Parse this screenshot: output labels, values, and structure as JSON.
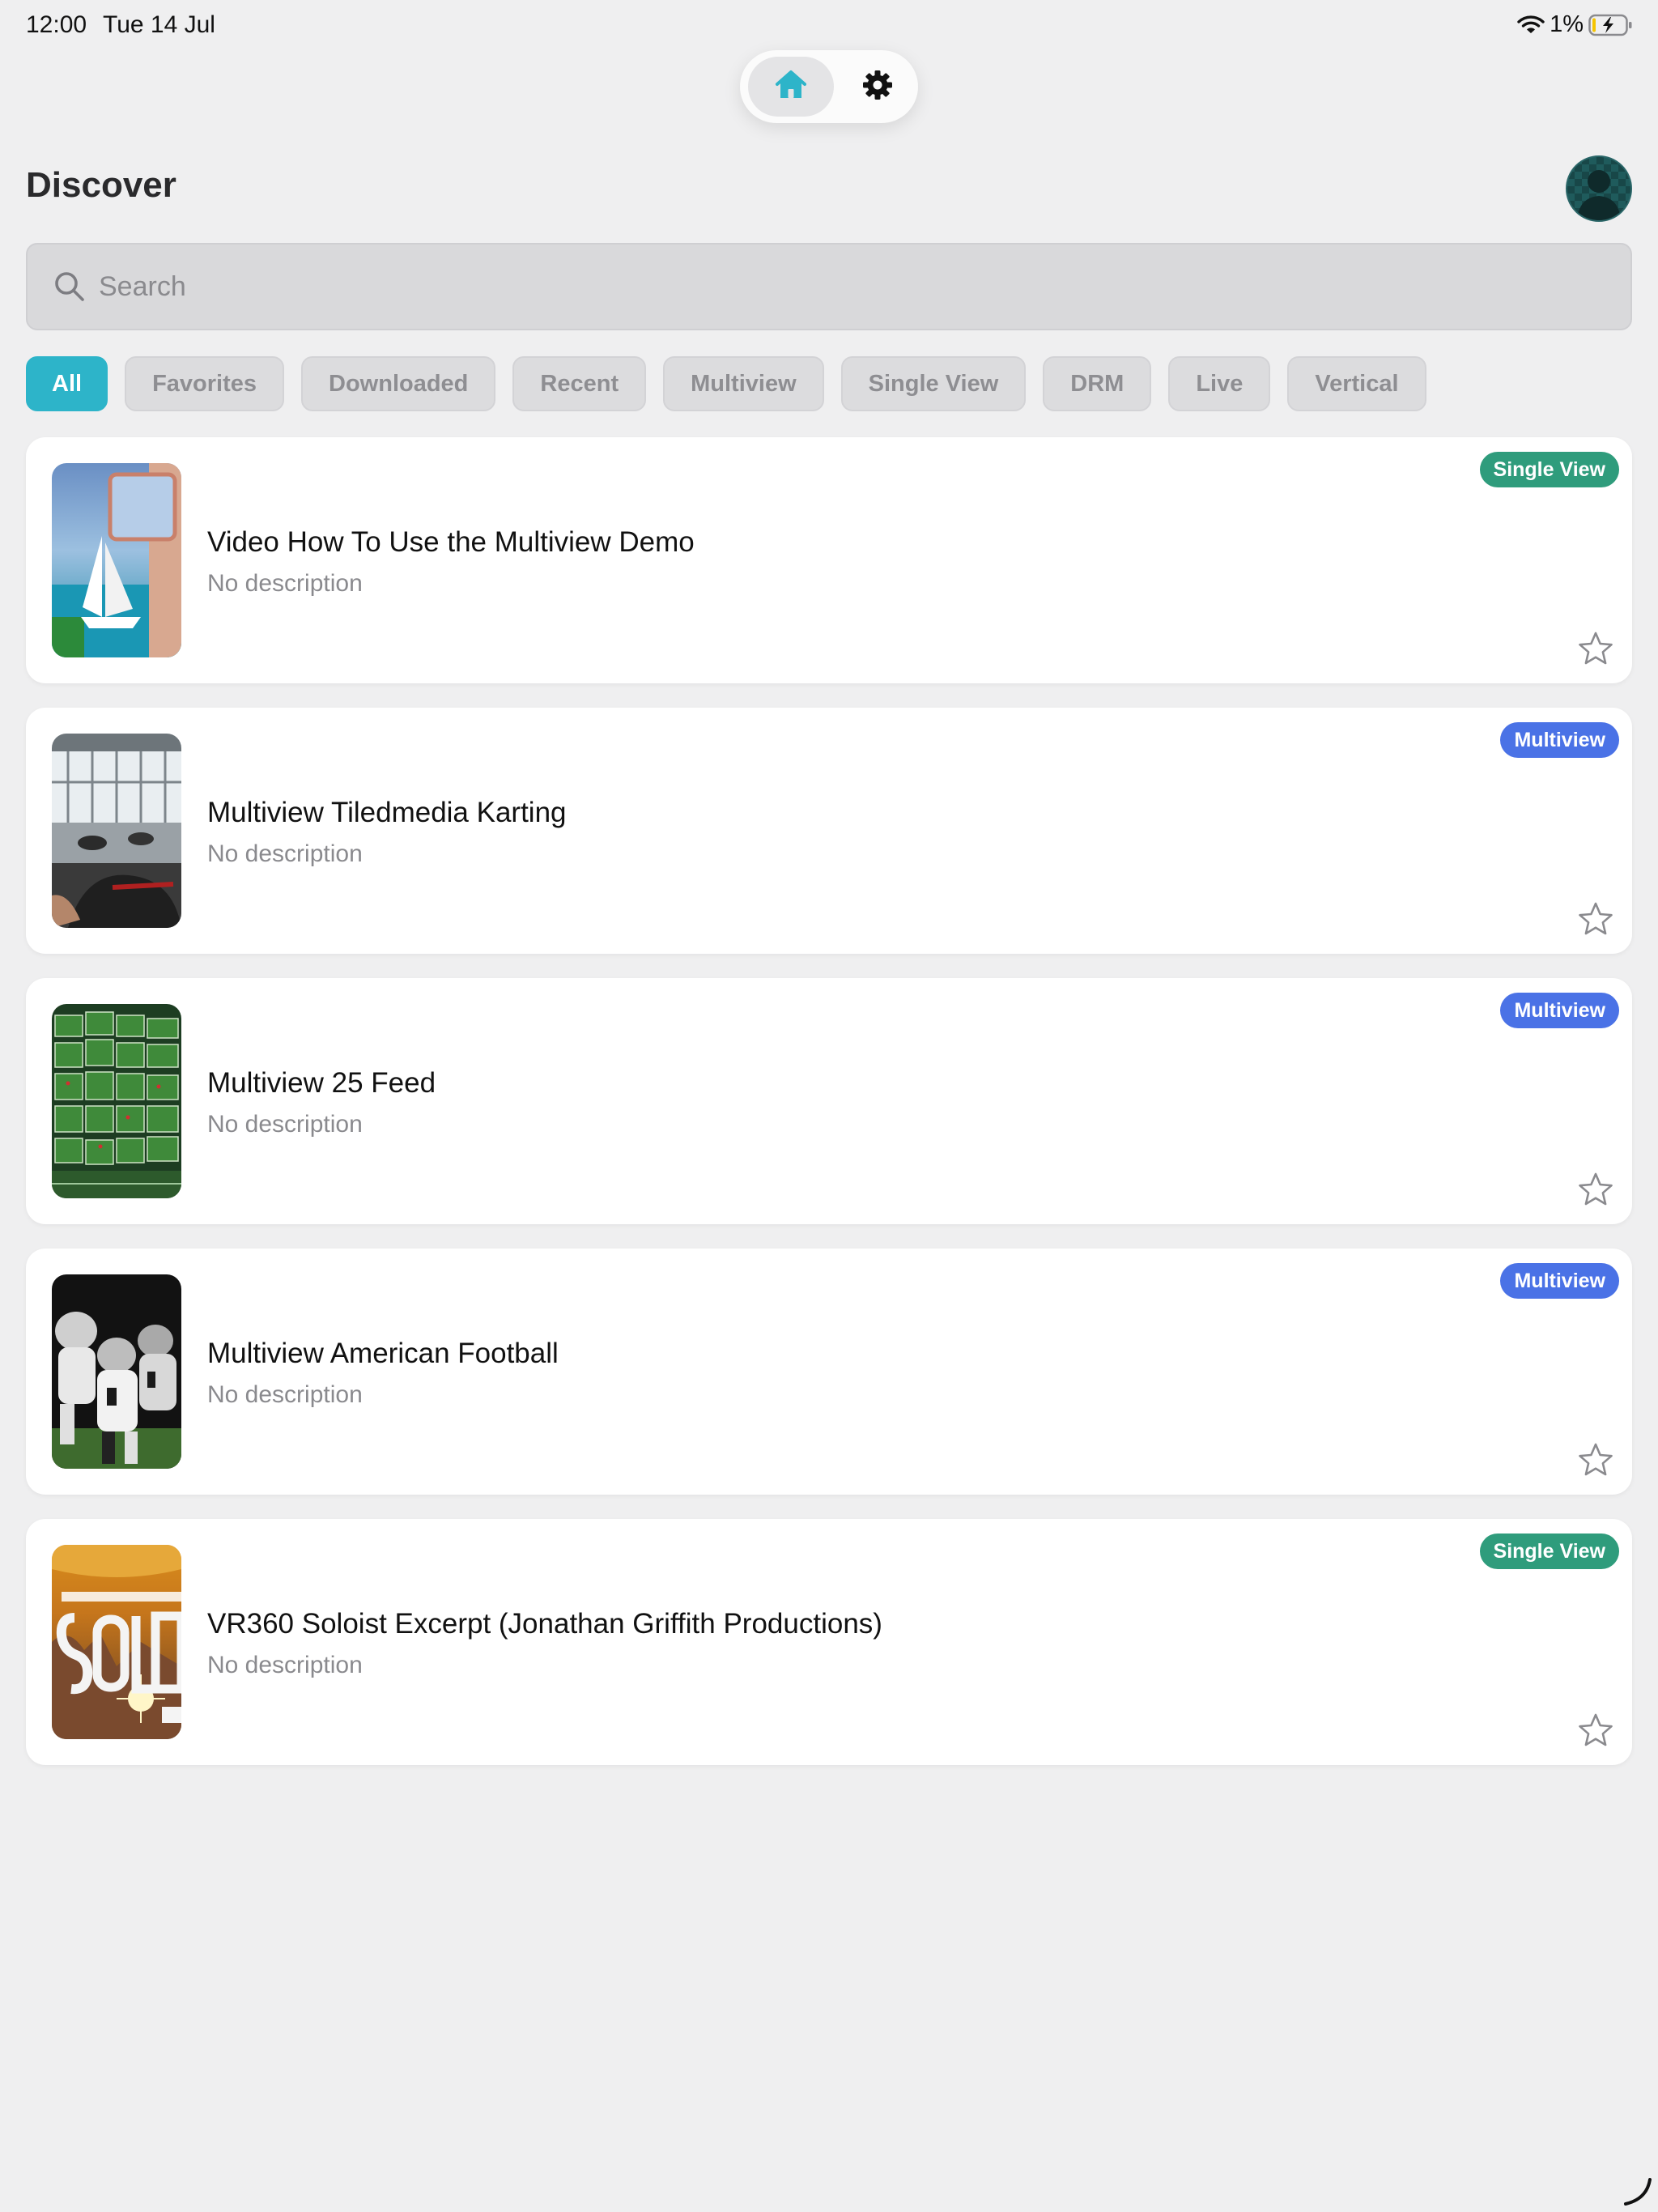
{
  "status_bar": {
    "time": "12:00",
    "date": "Tue 14 Jul",
    "battery": "1%"
  },
  "nav": {
    "home_icon": "home-icon",
    "settings_icon": "gear-icon",
    "accent": "#2db4c9"
  },
  "header": {
    "title": "Discover"
  },
  "search": {
    "placeholder": "Search",
    "value": ""
  },
  "filters": [
    {
      "label": "All",
      "active": true
    },
    {
      "label": "Favorites",
      "active": false
    },
    {
      "label": "Downloaded",
      "active": false
    },
    {
      "label": "Recent",
      "active": false
    },
    {
      "label": "Multiview",
      "active": false
    },
    {
      "label": "Single View",
      "active": false
    },
    {
      "label": "DRM",
      "active": false
    },
    {
      "label": "Live",
      "active": false
    },
    {
      "label": "Vertical",
      "active": false
    }
  ],
  "items": [
    {
      "title": "Video How To Use the Multiview Demo",
      "description": "No description",
      "badge": "Single View",
      "badge_type": "single",
      "favorite": false
    },
    {
      "title": "Multiview Tiledmedia Karting",
      "description": "No description",
      "badge": "Multiview",
      "badge_type": "multi",
      "favorite": false
    },
    {
      "title": "Multiview 25 Feed",
      "description": "No description",
      "badge": "Multiview",
      "badge_type": "multi",
      "favorite": false
    },
    {
      "title": "Multiview American Football",
      "description": "No description",
      "badge": "Multiview",
      "badge_type": "multi",
      "favorite": false
    },
    {
      "title": "VR360 Soloist Excerpt (Jonathan Griffith Productions)",
      "description": "No description",
      "badge": "Single View",
      "badge_type": "single",
      "favorite": false
    }
  ],
  "colors": {
    "single_view_badge": "#2f9c7c",
    "multiview_badge": "#4a72e6"
  }
}
